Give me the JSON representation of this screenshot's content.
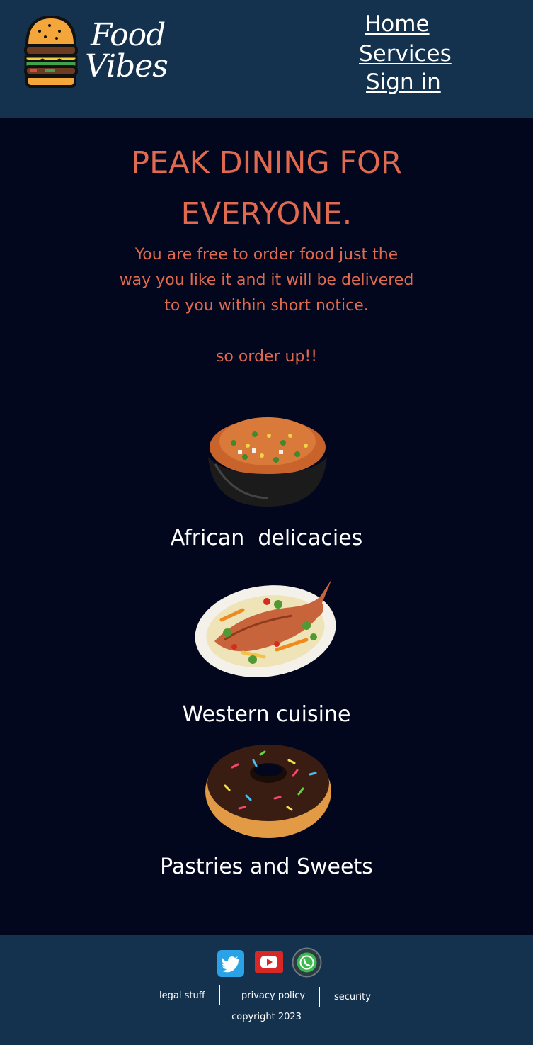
{
  "header": {
    "brand_line1": "Food",
    "brand_line2": "Vibes",
    "nav": {
      "home": "Home",
      "services": "Services",
      "signin": "Sign in"
    }
  },
  "hero": {
    "title_line1": "PEAK DINING FOR",
    "title_line2": "EVERYONE.",
    "text": "You are free to order food just the way you like it and it will be delivered to you within short notice.",
    "cta": "so order up!!"
  },
  "categories": [
    {
      "label": "African  delicacies",
      "icon": "rice-bowl-image"
    },
    {
      "label": "Western cuisine",
      "icon": "fish-plate-image"
    },
    {
      "label": "Pastries and Sweets",
      "icon": "donut-image"
    }
  ],
  "footer": {
    "social": [
      "twitter-icon",
      "youtube-icon",
      "whatsapp-icon"
    ],
    "links": {
      "legal": "legal stuff",
      "privacy": "privacy policy",
      "security": "security"
    },
    "copyright": "copyright 2023"
  },
  "colors": {
    "header_bg": "#14324e",
    "page_bg": "#02071e",
    "accent": "#e06a4f"
  }
}
